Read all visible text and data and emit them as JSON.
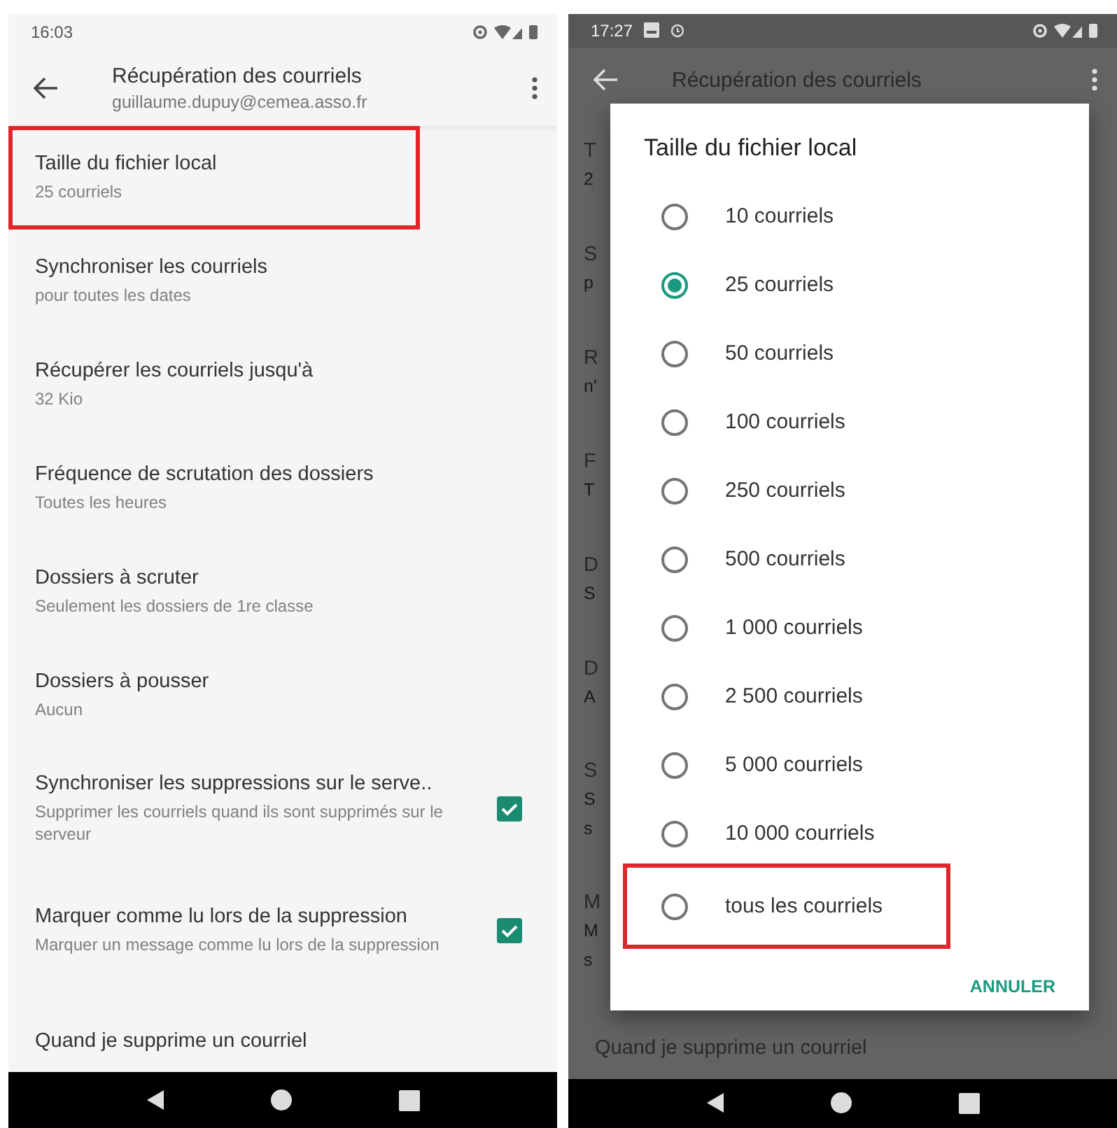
{
  "left_screen": {
    "status_bar": {
      "time": "16:03"
    },
    "toolbar": {
      "title": "Récupération des courriels",
      "subtitle": "guillaume.dupuy@cemea.asso.fr"
    },
    "settings": [
      {
        "kind": "text",
        "title": "Taille du fichier local",
        "summary": "25 courriels",
        "highlighted": true
      },
      {
        "kind": "text",
        "title": "Synchroniser les courriels",
        "summary": "pour toutes les dates",
        "highlighted": false
      },
      {
        "kind": "text",
        "title": "Récupérer les courriels jusqu'à",
        "summary": "32 Kio",
        "highlighted": false
      },
      {
        "kind": "text",
        "title": "Fréquence de scrutation des dossiers",
        "summary": "Toutes les heures",
        "highlighted": false
      },
      {
        "kind": "text",
        "title": "Dossiers à scruter",
        "summary": "Seulement les dossiers de 1re classe",
        "highlighted": false
      },
      {
        "kind": "text",
        "title": "Dossiers à pousser",
        "summary": "Aucun",
        "highlighted": false
      },
      {
        "kind": "checkbox",
        "title": "Synchroniser les suppressions sur le serve..",
        "summary": "Supprimer les courriels quand ils sont supprimés sur le serveur",
        "checked": true,
        "highlighted": false
      },
      {
        "kind": "checkbox",
        "title": "Marquer comme lu lors de la suppression",
        "summary": "Marquer un message comme lu lors de la suppression",
        "checked": true,
        "highlighted": false
      },
      {
        "kind": "title_only",
        "title": "Quand je supprime un courriel",
        "highlighted": false
      }
    ]
  },
  "right_screen": {
    "status_bar": {
      "time": "17:27"
    },
    "toolbar": {
      "title": "Récupération des courriels"
    },
    "background_fragments": [
      [
        "T",
        "2"
      ],
      [
        "S",
        "p"
      ],
      [
        "R",
        "n'"
      ],
      [
        "F",
        "T"
      ],
      [
        "D",
        "S"
      ],
      [
        "D",
        "A"
      ],
      [
        "S",
        "S",
        "s"
      ],
      [
        "M",
        "M",
        "s"
      ]
    ],
    "background_last_item": "Quand je supprime un courriel",
    "dialog": {
      "title": "Taille du fichier local",
      "options": [
        {
          "label": "10 courriels",
          "selected": false,
          "highlighted": false
        },
        {
          "label": "25 courriels",
          "selected": true,
          "highlighted": false
        },
        {
          "label": "50 courriels",
          "selected": false,
          "highlighted": false
        },
        {
          "label": "100 courriels",
          "selected": false,
          "highlighted": false
        },
        {
          "label": "250 courriels",
          "selected": false,
          "highlighted": false
        },
        {
          "label": "500 courriels",
          "selected": false,
          "highlighted": false
        },
        {
          "label": "1 000 courriels",
          "selected": false,
          "highlighted": false
        },
        {
          "label": "2 500 courriels",
          "selected": false,
          "highlighted": false
        },
        {
          "label": "5 000 courriels",
          "selected": false,
          "highlighted": false
        },
        {
          "label": "10 000 courriels",
          "selected": false,
          "highlighted": false
        },
        {
          "label": "tous les courriels",
          "selected": false,
          "highlighted": true
        }
      ],
      "cancel_button": "ANNULER"
    }
  }
}
